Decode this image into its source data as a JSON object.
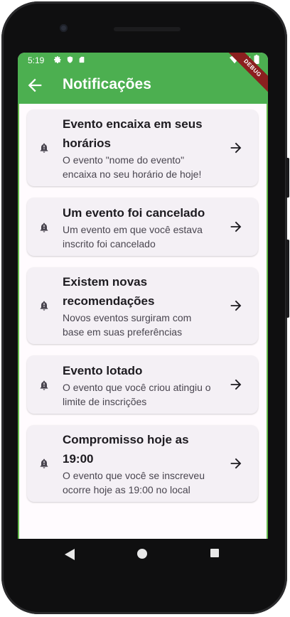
{
  "status_bar": {
    "time": "5:19"
  },
  "app_bar": {
    "title": "Notificações",
    "debug_banner": "DEBUG"
  },
  "notifications": [
    {
      "title": "Evento encaixa em seus horários",
      "description": "O evento \"nome do evento\" encaixa no seu horário de hoje!"
    },
    {
      "title": "Um evento foi cancelado",
      "description": "Um evento em que você estava inscrito foi cancelado"
    },
    {
      "title": "Existem novas recomendações",
      "description": "Novos eventos surgiram com base em suas preferências"
    },
    {
      "title": "Evento lotado",
      "description": "O evento que você criou atingiu o limite de inscrições"
    },
    {
      "title": "Compromisso hoje as 19:00",
      "description": "O evento que você se inscreveu ocorre hoje as 19:00 no local"
    }
  ],
  "colors": {
    "app_bar": "#4caf50",
    "card_bg": "#f4f0f5",
    "screen_bg": "#fffbfe"
  },
  "icons": {
    "card_leading": "bell-alert-icon",
    "card_trailing": "arrow-forward-icon",
    "toolbar": "arrow-back-icon"
  }
}
